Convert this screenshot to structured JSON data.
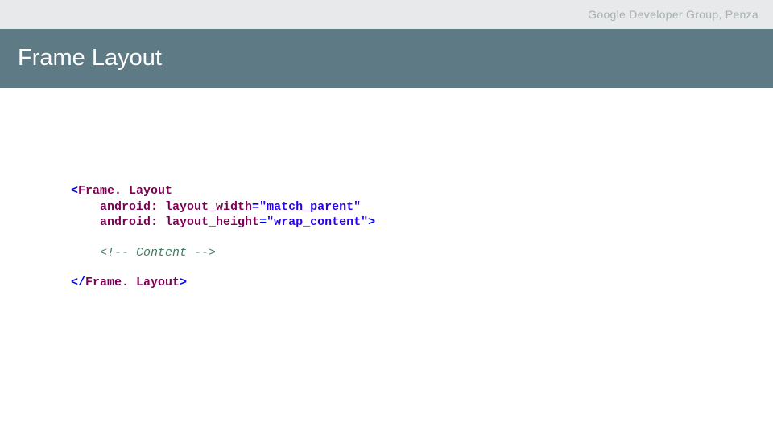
{
  "header": {
    "org": "Google Developer Group, Penza"
  },
  "title": "Frame Layout",
  "code": {
    "lt1": "<",
    "tag_open": "Frame. Layout",
    "indent": "    ",
    "attr_width_name": "android: layout_width",
    "eq": "=",
    "q": "\"",
    "attr_width_val": "match_parent",
    "attr_height_name": "android: layout_height",
    "attr_height_val": "wrap_content",
    "gt": ">",
    "comment": "<!-- Content -->",
    "lt_close": "</",
    "tag_close": "Frame. Layout",
    "gt2": ">"
  }
}
